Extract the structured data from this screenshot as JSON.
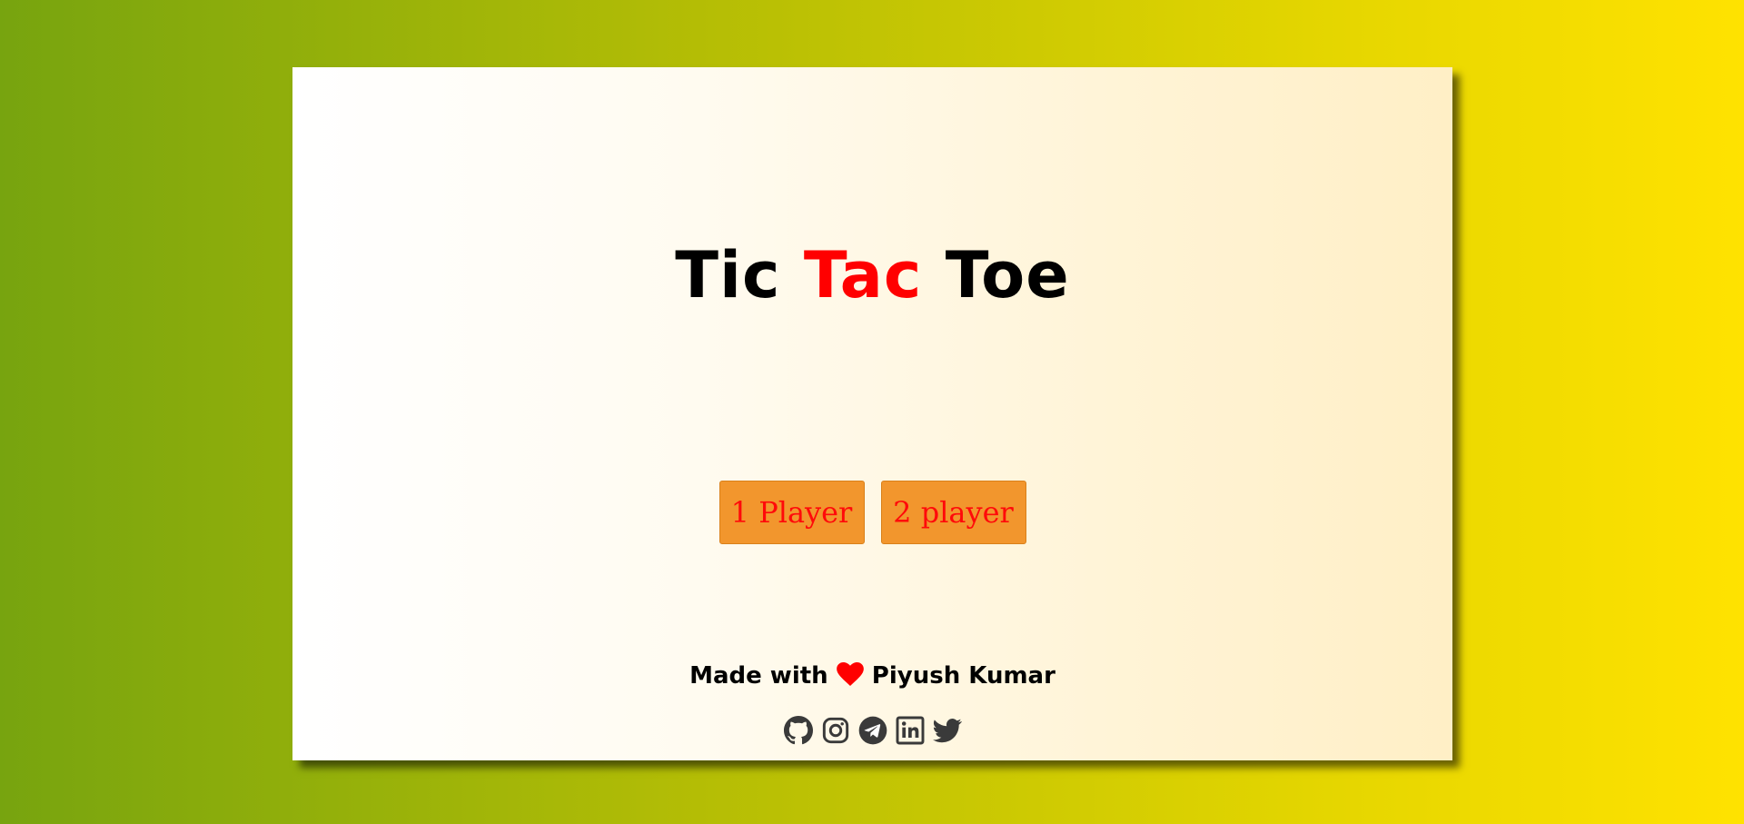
{
  "title": {
    "part1": "Tic",
    "part2": "Tac",
    "part3": "Toe"
  },
  "buttons": {
    "one_player": "1 Player",
    "two_player": "2 player"
  },
  "footer": {
    "made_with": "Made with",
    "author": "Piyush Kumar"
  },
  "social_icons": [
    "github-icon",
    "instagram-icon",
    "telegram-icon",
    "linkedin-icon",
    "twitter-icon"
  ],
  "colors": {
    "accent": "#ff0000",
    "button_bg": "#f2962d",
    "icon": "#3a3a3a"
  }
}
